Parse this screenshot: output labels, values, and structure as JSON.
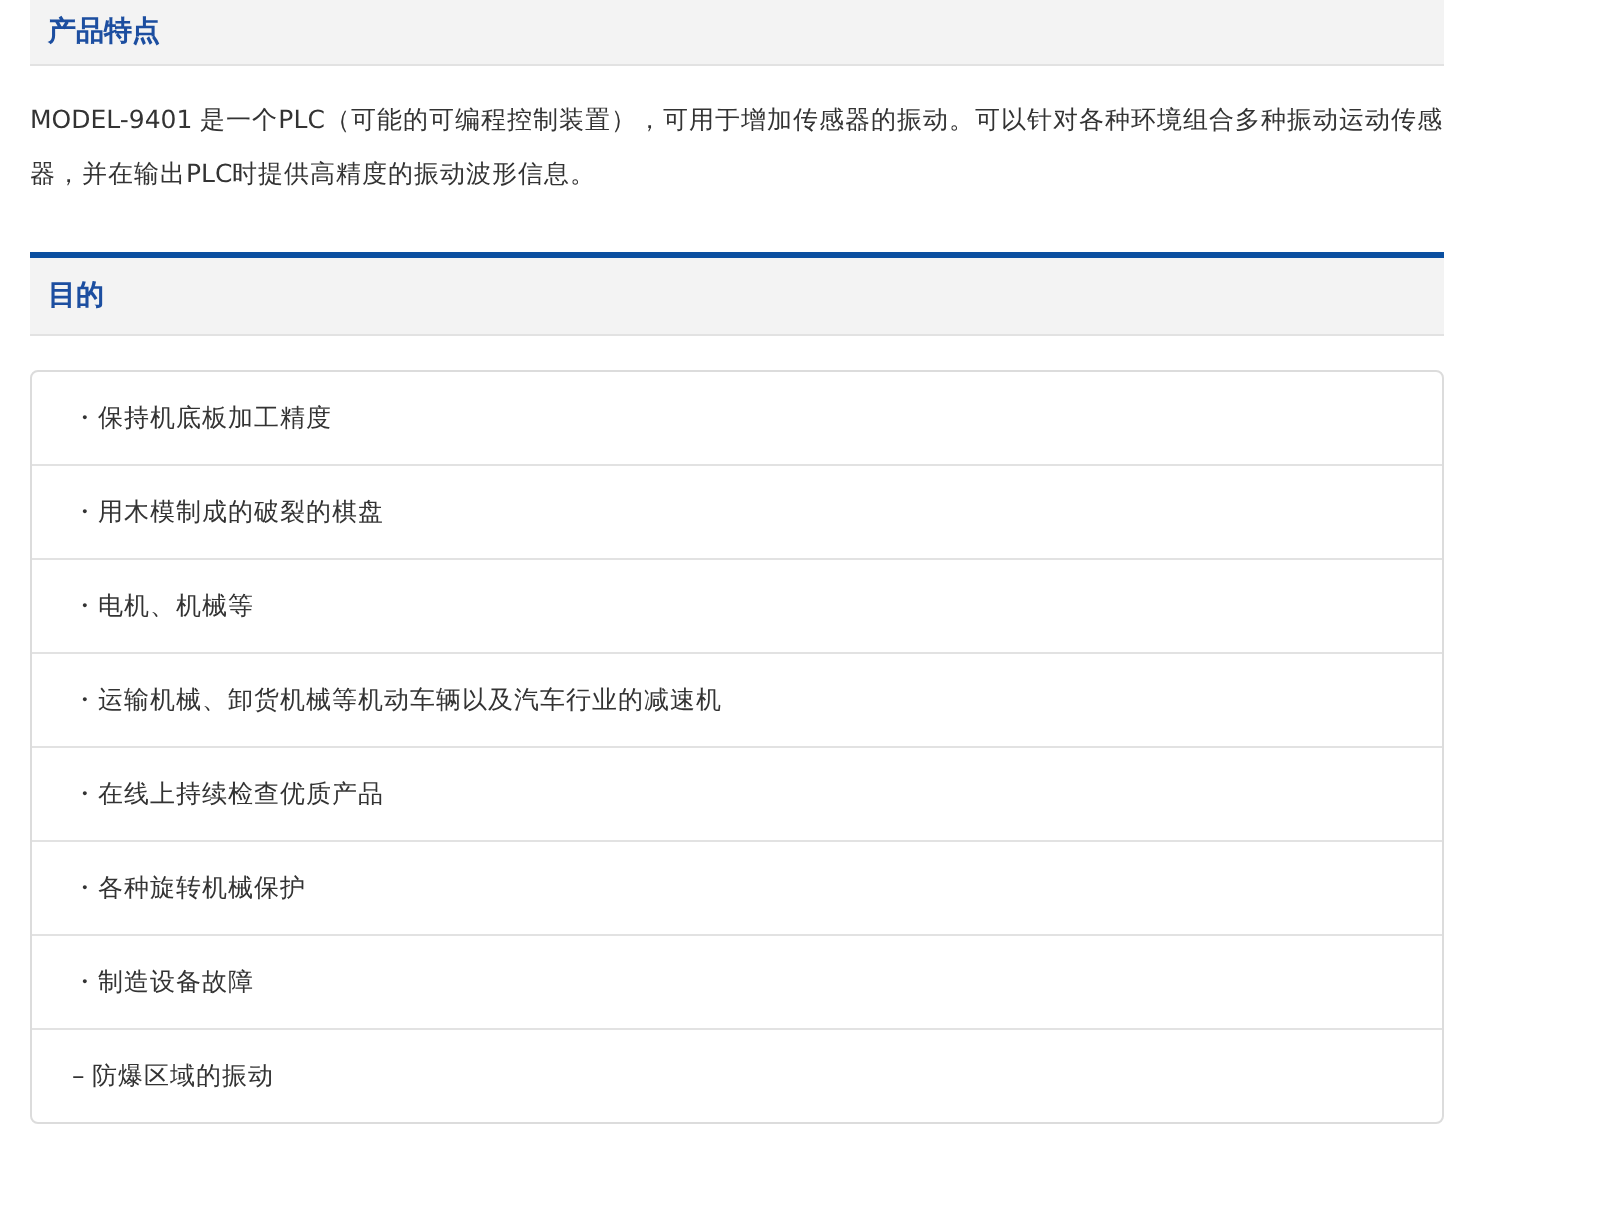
{
  "features": {
    "title": "产品特点",
    "text": "MODEL-9401 是一个PLC（可能的可编程控制装置），可用于增加传感器的振动。可以针对各种环境组合多种振动运动传感器，并在输出PLC时提供高精度的振动波形信息。"
  },
  "purpose": {
    "title": "目的",
    "items": [
      "・保持机底板加工精度",
      "・用木模制成的破裂的棋盘",
      "・电机、机械等",
      "・运输机械、卸货机械等机动车辆以及汽车行业的减速机",
      "・在线上持续检查优质产品",
      "・各种旋转机械保护",
      "・制造设备故障",
      "– 防爆区域的振动"
    ]
  }
}
